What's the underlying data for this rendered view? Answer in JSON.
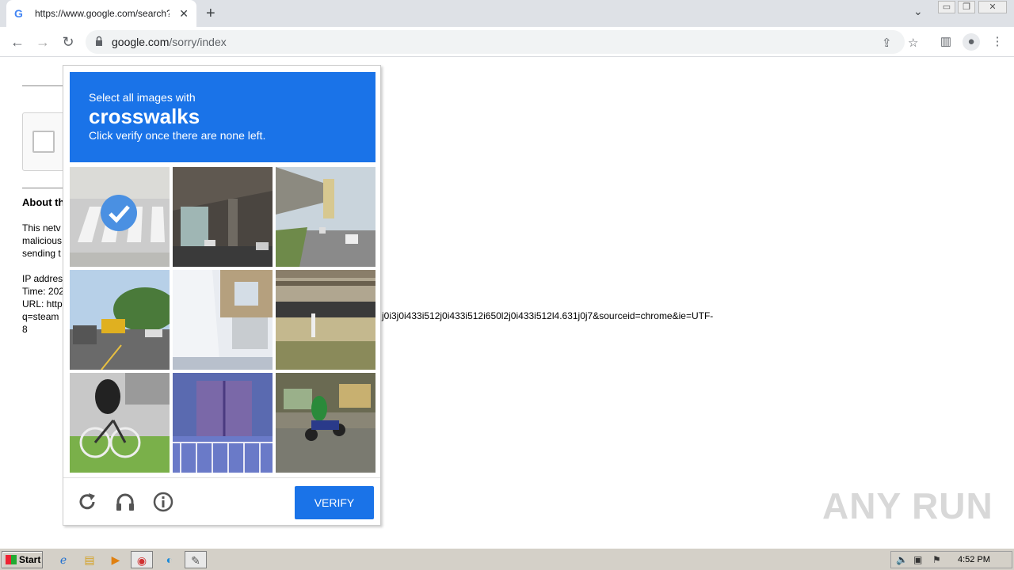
{
  "browser": {
    "tab_title": "https://www.google.com/search?q=",
    "tab_favicon": "G",
    "url_domain": "google.com",
    "url_path": "/sorry/index"
  },
  "page": {
    "about_heading": "About th",
    "para_lines": [
      "This netv",
      "malicious",
      "sending t"
    ],
    "info_lines": [
      "IP addres",
      "Time: 202",
      "URL: http",
      "q=steam",
      "8"
    ],
    "url_tail": "j0i3j0i433i512j0i433i512i650l2j0i433i512l4.631j0j7&sourceid=chrome&ie=UTF-"
  },
  "captcha": {
    "line1": "Select all images with",
    "keyword": "crosswalks",
    "line3": "Click verify once there are none left.",
    "verify_label": "VERIFY",
    "tiles": [
      {
        "desc": "crosswalk-street",
        "selected": true
      },
      {
        "desc": "overpass",
        "selected": false
      },
      {
        "desc": "elevated-road",
        "selected": false
      },
      {
        "desc": "street-bus",
        "selected": false
      },
      {
        "desc": "building-wall",
        "selected": false
      },
      {
        "desc": "parking-lot",
        "selected": false
      },
      {
        "desc": "cyclist",
        "selected": false
      },
      {
        "desc": "door",
        "selected": false
      },
      {
        "desc": "motorcycle",
        "selected": false
      }
    ]
  },
  "watermark": "ANY RUN",
  "taskbar": {
    "start_label": "Start",
    "clock": "4:52 PM"
  }
}
